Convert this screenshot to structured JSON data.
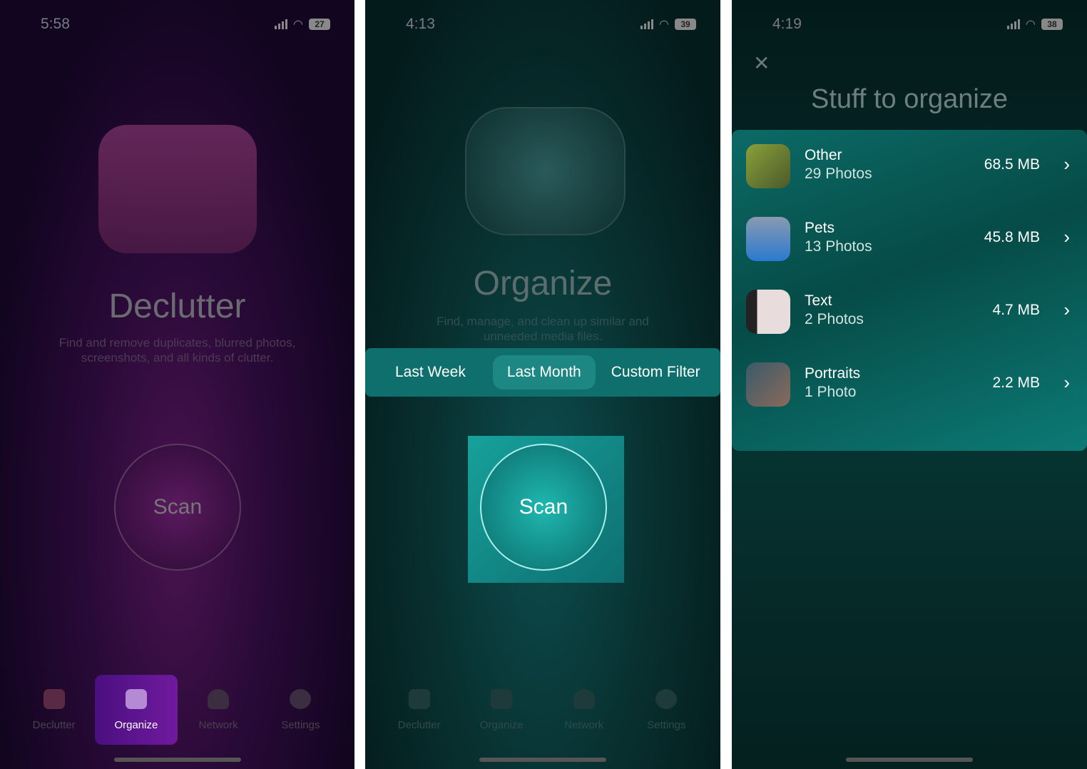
{
  "screens": [
    {
      "time": "5:58",
      "battery": "27",
      "title": "Declutter",
      "subtitle": "Find and remove duplicates, blurred photos, screenshots, and all kinds of clutter.",
      "scan_label": "Scan",
      "active_tab": "Organize"
    },
    {
      "time": "4:13",
      "battery": "39",
      "title": "Organize",
      "subtitle": "Find, manage, and clean up similar and unneeded media files.",
      "filters": [
        "Last Week",
        "Last Month",
        "Custom Filter"
      ],
      "selected_filter": "Last Month",
      "scan_label": "Scan"
    },
    {
      "time": "4:19",
      "battery": "38",
      "title": "Stuff to organize",
      "close_icon": "close-icon",
      "items": [
        {
          "name": "Other",
          "count": "29 Photos",
          "size": "68.5 MB"
        },
        {
          "name": "Pets",
          "count": "13 Photos",
          "size": "45.8 MB"
        },
        {
          "name": "Text",
          "count": "2 Photos",
          "size": "4.7 MB"
        },
        {
          "name": "Portraits",
          "count": "1 Photo",
          "size": "2.2 MB"
        }
      ]
    }
  ],
  "tabs": [
    "Declutter",
    "Organize",
    "Network",
    "Settings"
  ],
  "colors": {
    "purple_accent": "#6a1a9a",
    "teal_accent": "#0e7f7a"
  }
}
